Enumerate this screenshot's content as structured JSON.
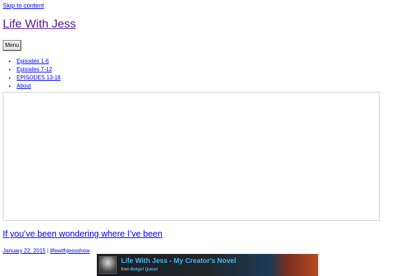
{
  "skip_link": "Skip to content",
  "site": {
    "title": "Life With Jess"
  },
  "menu": {
    "button_label": "Menu",
    "items": [
      "Episodes 1-6",
      "Episodes 7-12",
      "EPISODES 13-18",
      "About"
    ]
  },
  "post": {
    "title": "If you’ve been wondering where I’ve been",
    "date": "January 22, 2015",
    "separator": " | ",
    "author": "lifewithjessshow"
  },
  "video": {
    "title": "Life With Jess - My Creator's Novel",
    "from_label": "from ",
    "author": "Botgirl Questi"
  },
  "colors": {
    "link": "#0000ee",
    "visited": "#551a8b",
    "video_accent": "#44bbee"
  }
}
